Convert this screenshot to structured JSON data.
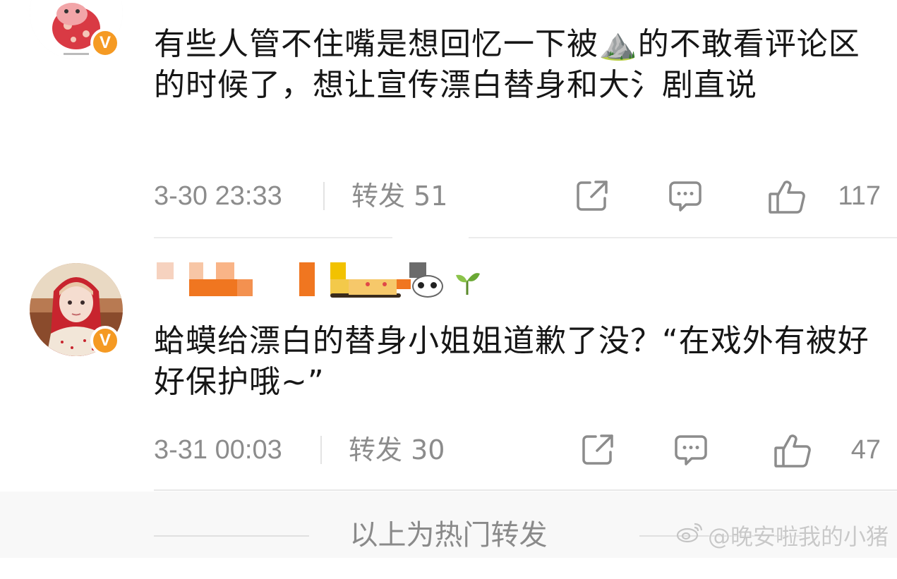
{
  "comments": [
    {
      "text": "有些人管不住嘴是想回忆一下被⛰️的不敢看评论区的时候了，想让宣传漂白替身和大氵剧直说",
      "time": "3-30 23:33",
      "repost": "转发 51",
      "likes": "117",
      "badge": "V"
    },
    {
      "text": "蛤蟆给漂白的替身小姐姐道歉了没？“在戏外有被好好保护哦~”",
      "time": "3-31 00:03",
      "repost": "转发 30",
      "likes": "47",
      "badge": "V"
    }
  ],
  "icons": {
    "share": "share-icon",
    "comment": "comment-icon",
    "like": "thumbs-up-icon"
  },
  "footer": {
    "label": "以上为热门转发"
  },
  "watermark": {
    "text": "@晚安啦我的小猪"
  },
  "colors": {
    "badge": "#f59a23",
    "meta": "#8c8c8c",
    "text": "#161616"
  }
}
